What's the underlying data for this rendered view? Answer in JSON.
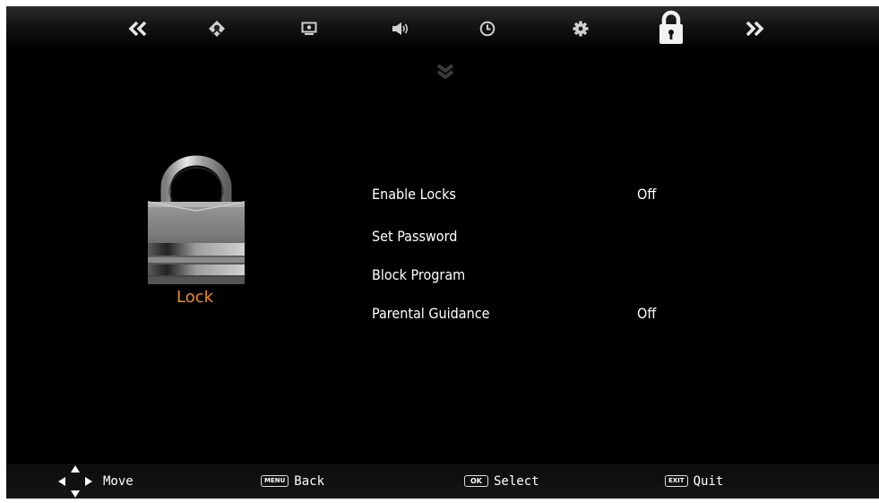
{
  "top_nav": {
    "tabs": [
      {
        "name": "prev-page",
        "icon": "double-chevron-left-icon"
      },
      {
        "name": "channel",
        "icon": "antenna-icon"
      },
      {
        "name": "picture",
        "icon": "monitor-icon"
      },
      {
        "name": "sound",
        "icon": "speaker-icon"
      },
      {
        "name": "time",
        "icon": "clock-icon"
      },
      {
        "name": "setup",
        "icon": "gear-icon"
      },
      {
        "name": "lock",
        "icon": "padlock-icon",
        "active": true
      },
      {
        "name": "next-page",
        "icon": "double-chevron-right-icon"
      }
    ]
  },
  "category": {
    "label": "Lock",
    "label_color": "#f08a1c",
    "icon": "padlock-icon"
  },
  "menu": {
    "items": [
      {
        "label": "Enable Locks",
        "value": "Off"
      },
      {
        "label": "Set Password",
        "value": ""
      },
      {
        "label": "Block Program",
        "value": ""
      },
      {
        "label": "Parental Guidance",
        "value": "Off"
      }
    ]
  },
  "footer": {
    "move_label": "Move",
    "back_key": "MENU",
    "back_label": "Back",
    "select_key": "OK",
    "select_label": "Select",
    "quit_key": "EXIT",
    "quit_label": "Quit"
  }
}
